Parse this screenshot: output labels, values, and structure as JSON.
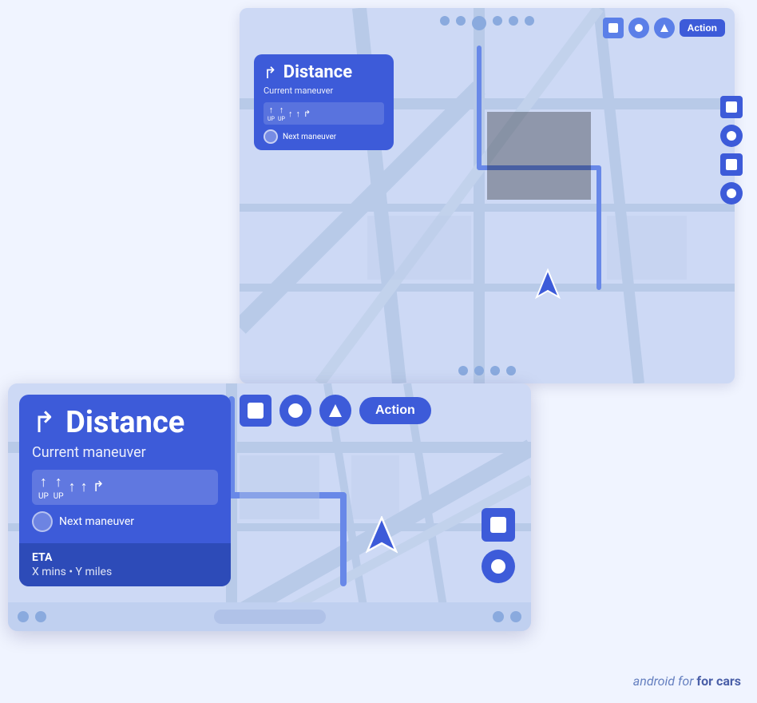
{
  "small_screen": {
    "action_button": "Action",
    "nav_card": {
      "distance": "Distance",
      "turn_icon": "↱",
      "maneuver": "Current maneuver",
      "lanes": [
        {
          "label": "UP",
          "arrow": "↑"
        },
        {
          "label": "UP",
          "arrow": "↑"
        },
        {
          "label": "",
          "arrow": "↑"
        },
        {
          "label": "",
          "arrow": "↑"
        },
        {
          "label": "",
          "arrow": "↱"
        }
      ],
      "next_maneuver": "Next maneuver"
    }
  },
  "large_screen": {
    "action_button": "Action",
    "nav_card": {
      "distance": "Distance",
      "turn_icon": "↱",
      "maneuver": "Current maneuver",
      "lanes": [
        {
          "label": "UP",
          "arrow": "↑"
        },
        {
          "label": "UP",
          "arrow": "↑"
        },
        {
          "label": "",
          "arrow": "↑"
        },
        {
          "label": "",
          "arrow": "↑"
        },
        {
          "label": "",
          "arrow": "↱"
        }
      ],
      "next_maneuver": "Next maneuver",
      "eta_label": "ETA",
      "eta_value": "X mins • Y miles"
    }
  },
  "brand": {
    "prefix": "android",
    "suffix": "for cars"
  },
  "colors": {
    "primary": "#3d5bd9",
    "map_bg": "#cdd9f5",
    "card_bg": "#3d5bd9",
    "accent": "#2d4bb8"
  }
}
